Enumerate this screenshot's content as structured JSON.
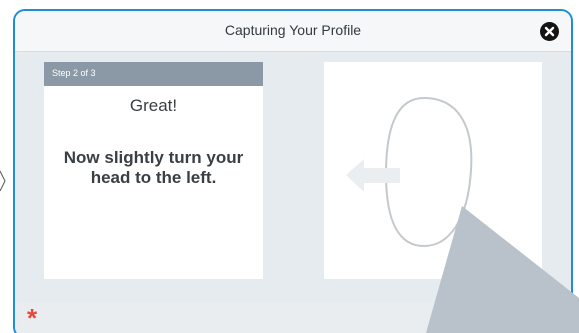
{
  "dialog": {
    "title": "Capturing Your Profile",
    "close_icon": "close-icon"
  },
  "step_card": {
    "step_label": "Step 2 of 3",
    "heading": "Great!",
    "instruction": "Now slightly turn your head to the left."
  },
  "guide_card": {
    "face_outline_icon": "face-outline-icon",
    "arrow_icon": "arrow-left-icon"
  },
  "footer": {
    "required_marker": "*"
  },
  "colors": {
    "dialog_border": "#1e8fd6",
    "step_bar": "#8b99a6",
    "required_marker": "#e8473b",
    "pointer_overlay": "#b9c2cb"
  }
}
